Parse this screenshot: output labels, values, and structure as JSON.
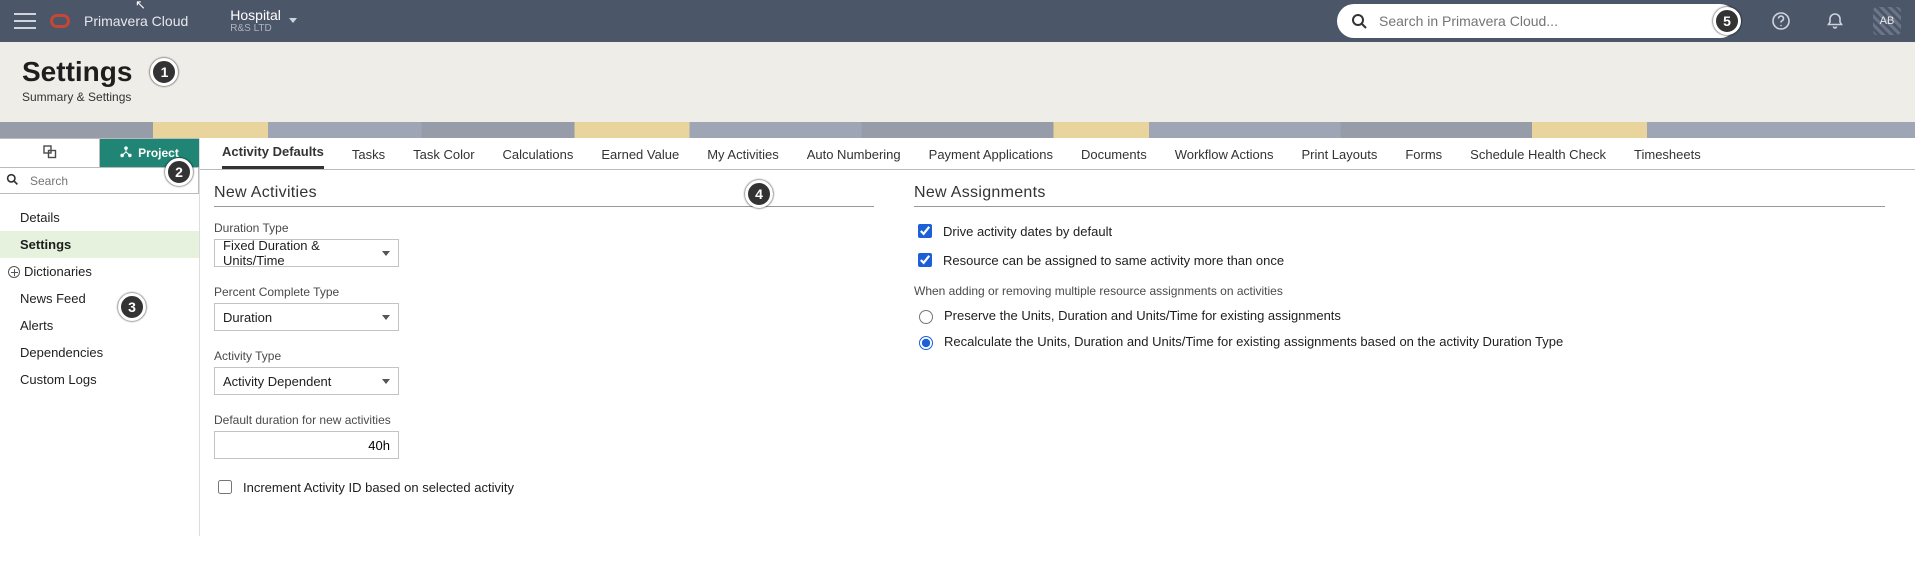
{
  "header": {
    "brand": "Primavera Cloud",
    "context": {
      "main": "Hospital",
      "sub": "R&S LTD"
    },
    "search_placeholder": "Search in Primavera Cloud...",
    "avatar_initials": "AB"
  },
  "callouts": [
    "1",
    "2",
    "3",
    "4",
    "5"
  ],
  "page": {
    "title": "Settings",
    "subtitle": "Summary & Settings"
  },
  "sidebar": {
    "tabs": {
      "project_label": "Project"
    },
    "search_placeholder": "Search",
    "items": [
      "Details",
      "Settings",
      "Dictionaries",
      "News Feed",
      "Alerts",
      "Dependencies",
      "Custom Logs"
    ],
    "selected_index": 1,
    "expandable_index": 2
  },
  "tabs": {
    "items": [
      "Activity Defaults",
      "Tasks",
      "Task Color",
      "Calculations",
      "Earned Value",
      "My Activities",
      "Auto Numbering",
      "Payment Applications",
      "Documents",
      "Workflow Actions",
      "Print Layouts",
      "Forms",
      "Schedule Health Check",
      "Timesheets"
    ],
    "active_index": 0
  },
  "activities": {
    "section_title": "New Activities",
    "duration_type": {
      "label": "Duration Type",
      "value": "Fixed Duration & Units/Time"
    },
    "percent_complete_type": {
      "label": "Percent Complete Type",
      "value": "Duration"
    },
    "activity_type": {
      "label": "Activity Type",
      "value": "Activity Dependent"
    },
    "default_duration": {
      "label": "Default duration for new activities",
      "value": "40h"
    },
    "increment_id": {
      "label": "Increment Activity ID based on selected activity",
      "checked": false
    }
  },
  "assignments": {
    "section_title": "New Assignments",
    "drive_dates": {
      "label": "Drive activity dates by default",
      "checked": true
    },
    "multi_assign": {
      "label": "Resource can be assigned to same activity more than once",
      "checked": true
    },
    "hint": "When adding or removing multiple resource assignments on activities",
    "radio": {
      "preserve": "Preserve the Units, Duration and Units/Time for existing assignments",
      "recalc": "Recalculate the Units, Duration and Units/Time for existing assignments based on the activity Duration Type",
      "selected": "recalc"
    }
  }
}
